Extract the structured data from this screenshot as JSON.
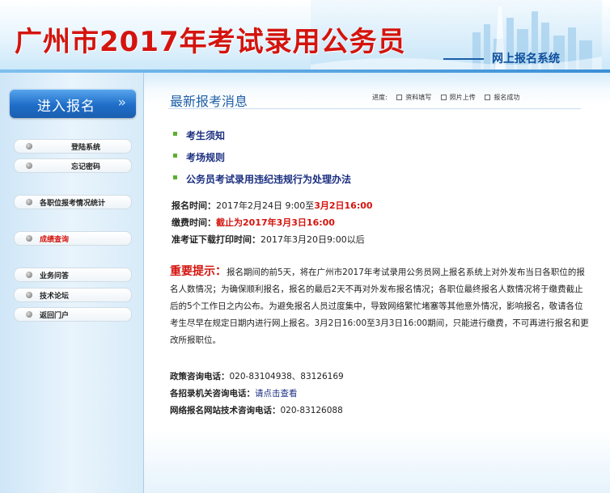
{
  "header": {
    "title": "广州市2017年考试录用公务员",
    "subtitle": "网上报名系统"
  },
  "sidebar": {
    "enter_button": "进入报名",
    "enter_arrow": "»",
    "items": [
      {
        "label": "登陆系统"
      },
      {
        "label": "忘记密码"
      },
      {
        "label": "各职位报考情况统计"
      },
      {
        "label": "成绩查询"
      },
      {
        "label": "业务问答"
      },
      {
        "label": "技术论坛"
      },
      {
        "label": "返回门户"
      }
    ]
  },
  "main": {
    "section_title": "最新报考消息",
    "progress_label": "进度:",
    "progress_steps": [
      {
        "label": "资料填写"
      },
      {
        "label": "照片上传"
      },
      {
        "label": "报名成功"
      }
    ],
    "links": [
      {
        "label": "考生须知"
      },
      {
        "label": "考场规则"
      },
      {
        "label": "公务员考试录用违纪违规行为处理办法"
      }
    ],
    "info": {
      "reg_label": "报名时间：",
      "reg_value": "2017年2月24日 9:00至",
      "reg_end": "3月2日16:00",
      "pay_label": "缴费时间：",
      "pay_value": "截止为2017年3月3日16:00",
      "print_label": "准考证下载打印时间：",
      "print_value": "2017年3月20日9:00以后"
    },
    "notice": {
      "lead": "重要提示：",
      "body": "报名期间的前5天，将在广州市2017年考试录用公务员网上报名系统上对外发布当日各职位的报名人数情况；为确保顺利报名，报名的最后2天不再对外发布报名情况；各职位最终报名人数情况将于缴费截止后的5个工作日之内公布。为避免报名人员过度集中，导致网络繁忙堵塞等其他意外情况，影响报名，敬请各位考生尽早在规定日期内进行网上报名。3月2日16:00至3月3日16:00期间，只能进行缴费，不可再进行报名和更改所报职位。"
    },
    "contacts": {
      "policy_label": "政策咨询电话：",
      "policy_value": "020-83104938、83126169",
      "org_label": "各招录机关咨询电话：",
      "org_value": "请点击查看",
      "tech_label": "网络报名网站技术咨询电话：",
      "tech_value": "020-83126088"
    }
  },
  "colors": {
    "title_red": "#d4140e",
    "link_blue": "#1b2f80",
    "accent_blue": "#1f6ec9",
    "bullet_green": "#5bb030"
  }
}
